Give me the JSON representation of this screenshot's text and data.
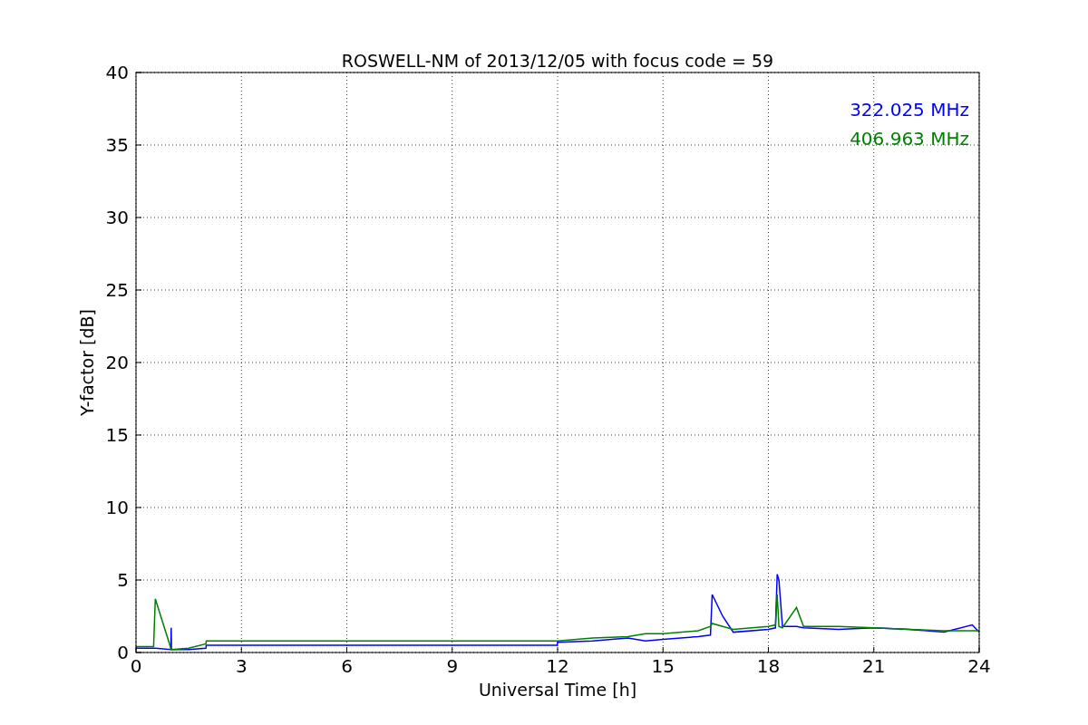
{
  "figure": {
    "chart_data": {
      "type": "line",
      "title": "ROSWELL-NM of 2013/12/05 with focus code = 59",
      "xlabel": "Universal Time [h]",
      "ylabel": "Y-factor [dB]",
      "x": [
        0,
        0.5,
        0.55,
        0.99,
        1.0,
        1.01,
        1.5,
        1.99,
        2.0,
        11.99,
        12.0,
        13,
        14,
        14.5,
        15,
        16,
        16.35,
        16.4,
        16.7,
        17,
        18,
        18.2,
        18.25,
        18.3,
        18.4,
        18.8,
        19,
        20,
        21,
        22,
        23,
        23.8,
        24
      ],
      "series": [
        {
          "name": "322.025 MHz",
          "color": "#0000ff",
          "values": [
            0.3,
            0.3,
            0.3,
            0.2,
            1.7,
            0.2,
            0.2,
            0.3,
            0.5,
            0.5,
            0.7,
            0.8,
            1.0,
            0.8,
            0.9,
            1.1,
            1.2,
            4.0,
            2.5,
            1.4,
            1.6,
            1.7,
            5.4,
            5.0,
            1.8,
            1.8,
            1.7,
            1.6,
            1.7,
            1.6,
            1.4,
            1.9,
            1.4
          ]
        },
        {
          "name": "406.963 MHz",
          "color": "#008000",
          "values": [
            0.4,
            0.4,
            3.7,
            0.3,
            0.2,
            0.2,
            0.3,
            0.6,
            0.8,
            0.8,
            0.8,
            1.0,
            1.1,
            1.3,
            1.3,
            1.5,
            1.8,
            2.0,
            1.8,
            1.6,
            1.8,
            1.9,
            4.0,
            1.8,
            1.7,
            3.1,
            1.8,
            1.8,
            1.7,
            1.6,
            1.5,
            1.5,
            1.5
          ]
        }
      ],
      "xlim": [
        0,
        24
      ],
      "ylim": [
        0,
        40
      ],
      "xticks": [
        0,
        3,
        6,
        9,
        12,
        15,
        18,
        21,
        24
      ],
      "yticks": [
        0,
        5,
        10,
        15,
        20,
        25,
        30,
        35,
        40
      ],
      "grid": true
    }
  }
}
